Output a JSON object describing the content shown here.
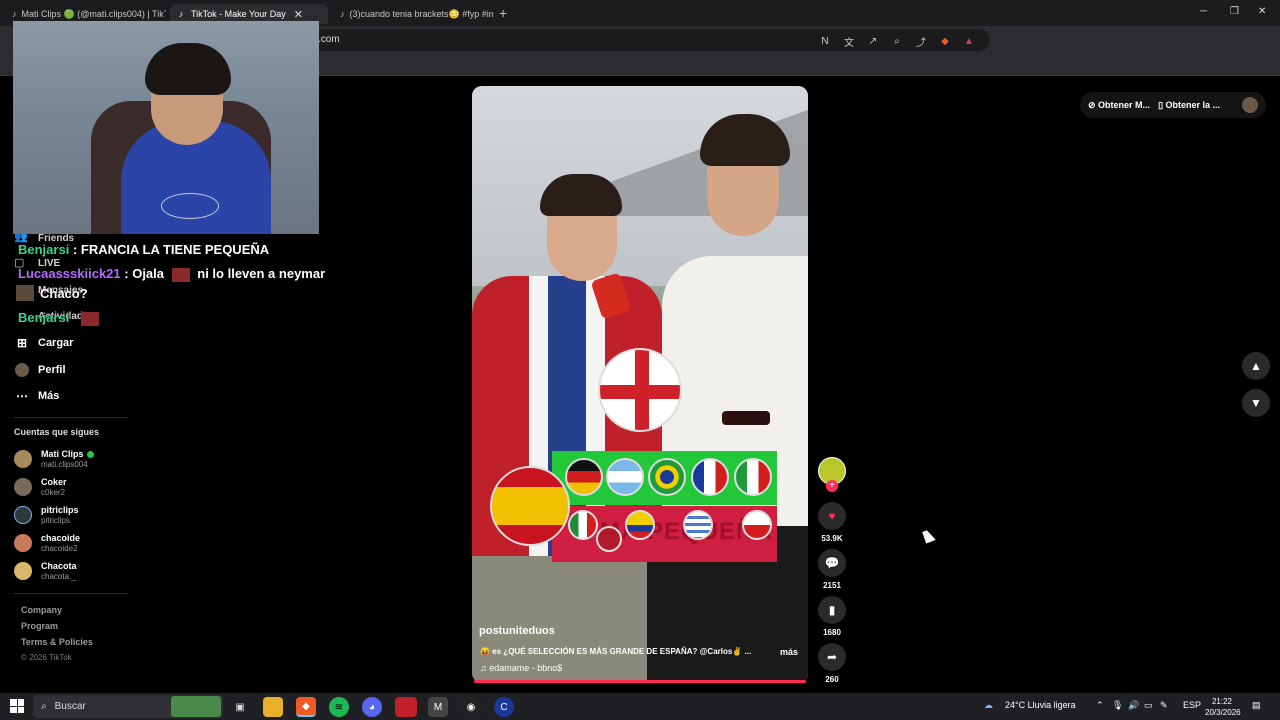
{
  "browser": {
    "tabs": [
      {
        "label": "Mati Clips 🟢 (@mati.clips004) | TikTo",
        "active": false
      },
      {
        "label": "TikTok - Make Your Day",
        "active": true
      },
      {
        "label": "(3)cuando tenia brackets😳 #fyp #in",
        "active": false
      }
    ],
    "url": ".com"
  },
  "chat": [
    {
      "user": "Benjarsi",
      "message": ": FRANCIA LA TIENE PEQUEÑA",
      "color": "#3fd08a"
    },
    {
      "user": "Lucaassskiick21",
      "message": ": Ojala",
      "message2": "ni lo lleven a neymar",
      "color": "#b86bff"
    },
    {
      "user": "",
      "message": "Chaco?",
      "color": "#ffffff"
    },
    {
      "user": "Benjarsi",
      "message": "",
      "color": "#3fd08a"
    }
  ],
  "sidebar": {
    "ghost_items": [
      {
        "label": "Friends"
      },
      {
        "label": "LIVE"
      },
      {
        "label": "Mensajes"
      },
      {
        "label": "Actividad"
      }
    ],
    "items": [
      {
        "label": "Cargar",
        "icon": "plus-square-icon"
      },
      {
        "label": "Perfil",
        "icon": "avatar-icon"
      },
      {
        "label": "Más",
        "icon": "ellipsis-icon"
      }
    ],
    "following_title": "Cuentas que sigues",
    "accounts": [
      {
        "name": "Mati Clips",
        "username": "mati.clips004",
        "live": true,
        "color": "#a88a5a"
      },
      {
        "name": "Coker",
        "username": "c0ker2",
        "live": false,
        "color": "#7a6a5a"
      },
      {
        "name": "pitriclips",
        "username": "pitriclips",
        "live": false,
        "color": "#2a3a3a"
      },
      {
        "name": "chacoide",
        "username": "chacoide2",
        "live": false,
        "color": "#c87a5a"
      },
      {
        "name": "Chacota",
        "username": "chacota._",
        "live": false,
        "color": "#d8b86a"
      }
    ],
    "footer": {
      "links": [
        "Company",
        "Program",
        "Terms & Policies"
      ],
      "copyright": "© 2026 TikTok"
    }
  },
  "video": {
    "overlay_text": "MÁ PEQUEÑA",
    "username": "postuniteduos",
    "description": "😝 es ¿QUÉ SELECCIÓN ES MÁS GRANDE DE ESPAÑA? @Carlos✌️ ...",
    "more": "más",
    "music": "edamame - bbno$"
  },
  "actions": {
    "likes": "53.9K",
    "comments": "2151",
    "saves": "1680",
    "shares": "260"
  },
  "top_right": {
    "btn1": "Obtener M...",
    "btn2": "Obtener la ..."
  },
  "taskbar": {
    "search_placeholder": "Buscar",
    "weather": "24°C  Lluvia ligera",
    "lang": "ESP",
    "time": "21:22",
    "date": "20/3/2026"
  },
  "colors": {
    "accent": "#fe2c55",
    "live": "#2ec24a",
    "background": "#000000"
  }
}
